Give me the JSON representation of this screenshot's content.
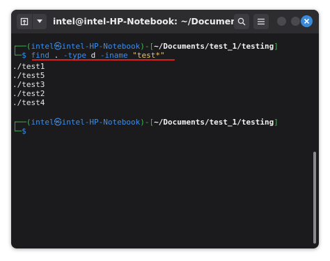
{
  "window": {
    "title": "intel@intel-HP-Notebook: ~/Documents/tes..."
  },
  "toolbar": {
    "new_tab_icon": "new-tab-icon",
    "dropdown_icon": "chevron-down-icon",
    "search_icon": "search-icon",
    "menu_icon": "hamburger-menu-icon",
    "close_icon": "close-icon"
  },
  "terminal": {
    "prompt1": {
      "corner_top": "┌──(",
      "user": "intel",
      "at": "㉿",
      "host": "intel-HP-Notebook",
      "mid": ")-[",
      "path": "~/Documents/test_1/testing",
      "end": "]",
      "corner_bottom": "└─",
      "dollar": "$",
      "cmd_find": "find",
      "cmd_dot": " . ",
      "cmd_type": "-type",
      "cmd_d": " d ",
      "cmd_iname": "-iname",
      "cmd_space": " ",
      "cmd_pattern": "\"test*\""
    },
    "output": [
      "./test1",
      "./test5",
      "./test3",
      "./test2",
      "./test4"
    ],
    "prompt2": {
      "corner_top": "┌──(",
      "user": "intel",
      "at": "㉿",
      "host": "intel-HP-Notebook",
      "mid": ")-[",
      "path": "~/Documents/test_1/testing",
      "end": "]",
      "corner_bottom": "└─",
      "dollar": "$"
    }
  },
  "colors": {
    "prompt_frame": "#3fb950",
    "prompt_user": "#3b8eea",
    "command": "#3b8eea",
    "pattern": "#e9c46a",
    "underline": "#d42020",
    "close_button": "#3b8ad9"
  }
}
